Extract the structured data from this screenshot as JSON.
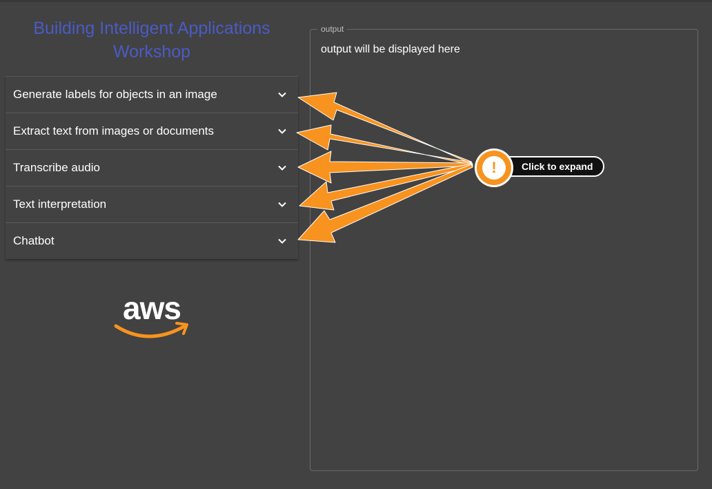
{
  "app": {
    "title": "Building Intelligent Applications Workshop"
  },
  "accordion": {
    "items": [
      {
        "label": "Generate labels for objects in an image",
        "icon": "chevron-down-icon"
      },
      {
        "label": "Extract text from images or documents",
        "icon": "chevron-down-icon"
      },
      {
        "label": "Transcribe audio",
        "icon": "chevron-down-icon"
      },
      {
        "label": "Text interpretation",
        "icon": "chevron-down-icon"
      },
      {
        "label": "Chatbot",
        "icon": "chevron-down-icon"
      }
    ]
  },
  "logo": {
    "text": "aws",
    "icon": "aws-logo"
  },
  "output": {
    "legend": "output",
    "placeholder_text": "output will be displayed here"
  },
  "callout": {
    "label": "Click to expand",
    "icon": "exclamation-icon",
    "symbol": "!"
  },
  "colors": {
    "background": "#424242",
    "title": "#4a5bc4",
    "accent_orange": "#f7931e",
    "text": "#ffffff"
  }
}
